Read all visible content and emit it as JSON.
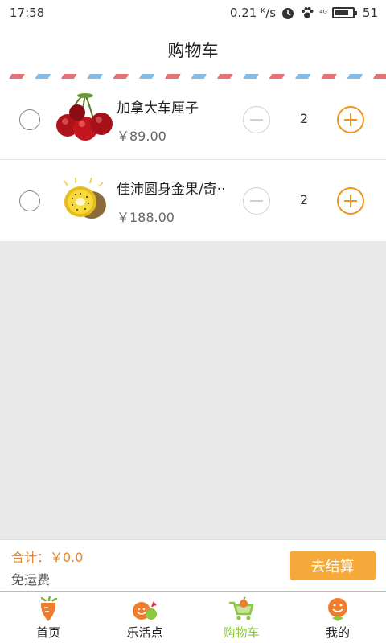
{
  "status_bar": {
    "time": "17:58",
    "speed": "0.21 ᴷ/s",
    "signal": "⁴ᴳ",
    "battery": "51"
  },
  "header": {
    "title": "购物车"
  },
  "cart": {
    "items": [
      {
        "name": "加拿大车厘子",
        "price": "￥89.00",
        "quantity": "2",
        "image": "cherries"
      },
      {
        "name": "佳沛圆身金果/奇··",
        "price": "￥188.00",
        "quantity": "2",
        "image": "kiwi"
      }
    ]
  },
  "summary": {
    "total_label": "合计：￥0.0",
    "shipping": "免运费",
    "checkout_label": "去结算"
  },
  "tabs": [
    {
      "label": "首页",
      "icon": "carrot-home-icon",
      "active": false
    },
    {
      "label": "乐活点",
      "icon": "faces-icon",
      "active": false
    },
    {
      "label": "购物车",
      "icon": "cart-icon",
      "active": true
    },
    {
      "label": "我的",
      "icon": "smiley-icon",
      "active": false
    }
  ],
  "colors": {
    "accent": "#f29318",
    "checkout": "#f6a93b",
    "active_tab": "#8dc63f"
  }
}
